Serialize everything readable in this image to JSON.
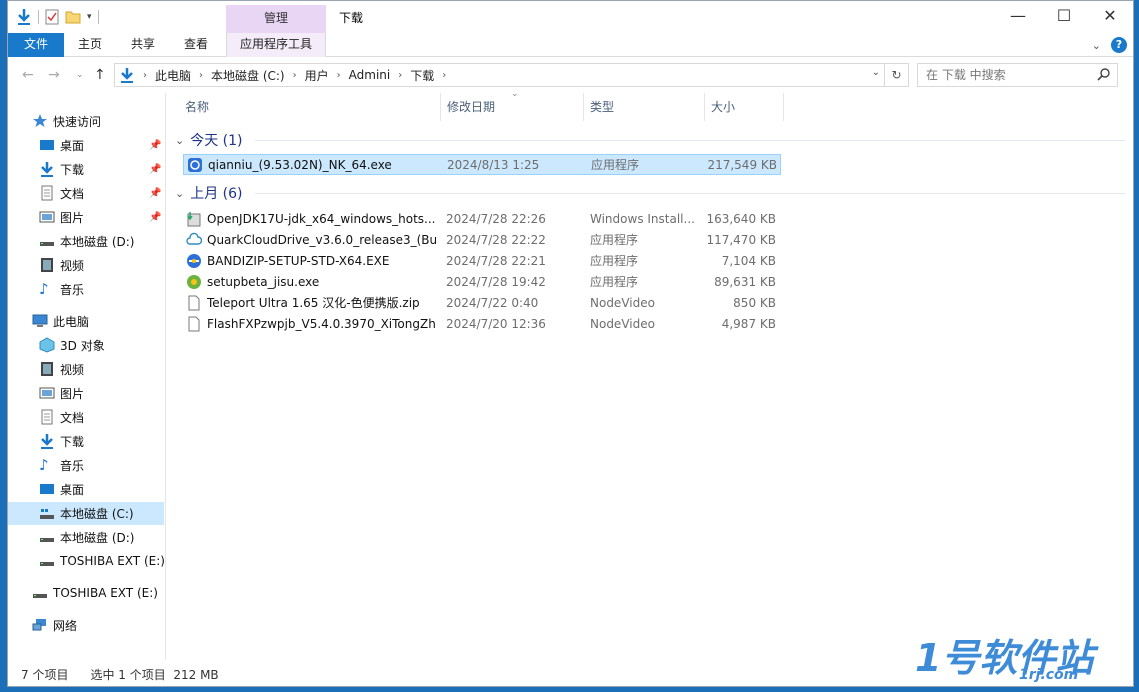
{
  "window": {
    "title": "下载",
    "context_tab_group": "管理",
    "controls": [
      "—",
      "☐",
      "✕"
    ]
  },
  "ribbon": {
    "tabs": [
      "文件",
      "主页",
      "共享",
      "查看",
      "应用程序工具"
    ]
  },
  "address": {
    "crumbs": [
      "此电脑",
      "本地磁盘 (C:)",
      "用户",
      "Admini",
      "下载"
    ],
    "search_placeholder": "在 下载 中搜索"
  },
  "nav": {
    "quick_access": "快速访问",
    "quick_items": [
      "桌面",
      "下载",
      "文档",
      "图片",
      "本地磁盘 (D:)",
      "视频",
      "音乐"
    ],
    "this_pc": "此电脑",
    "pc_items": [
      "3D 对象",
      "视频",
      "图片",
      "文档",
      "下载",
      "音乐",
      "桌面",
      "本地磁盘 (C:)",
      "本地磁盘 (D:)",
      "TOSHIBA EXT (E:)"
    ],
    "external": "TOSHIBA EXT (E:)",
    "network": "网络"
  },
  "columns": [
    "名称",
    "修改日期",
    "类型",
    "大小"
  ],
  "groups": [
    {
      "label": "今天 (1)",
      "files": [
        {
          "name": "qianniu_(9.53.02N)_NK_64.exe",
          "date": "2024/8/13 1:25",
          "type": "应用程序",
          "size": "217,549 KB",
          "icon": "app-icon"
        }
      ]
    },
    {
      "label": "上月 (6)",
      "files": [
        {
          "name": "OpenJDK17U-jdk_x64_windows_hots...",
          "date": "2024/7/28 22:26",
          "type": "Windows Install...",
          "size": "163,640 KB",
          "icon": "msi-icon"
        },
        {
          "name": "QuarkCloudDrive_v3.6.0_release3_(Bu...",
          "date": "2024/7/28 22:22",
          "type": "应用程序",
          "size": "117,470 KB",
          "icon": "cloud-icon"
        },
        {
          "name": "BANDIZIP-SETUP-STD-X64.EXE",
          "date": "2024/7/28 22:21",
          "type": "应用程序",
          "size": "7,104 KB",
          "icon": "bandizip-icon"
        },
        {
          "name": "setupbeta_jisu.exe",
          "date": "2024/7/28 19:42",
          "type": "应用程序",
          "size": "89,631 KB",
          "icon": "setup-icon"
        },
        {
          "name": "Teleport Ultra 1.65 汉化-色便携版.zip",
          "date": "2024/7/22 0:40",
          "type": "NodeVideo",
          "size": "850 KB",
          "icon": "document-icon"
        },
        {
          "name": "FlashFXPzwpjb_V5.4.0.3970_XiTongZh...",
          "date": "2024/7/20 12:36",
          "type": "NodeVideo",
          "size": "4,987 KB",
          "icon": "document-icon"
        }
      ]
    }
  ],
  "status": {
    "count": "7 个项目",
    "selected": "选中 1 个项目",
    "size": "212 MB"
  },
  "watermark": {
    "main": "1号软件站",
    "sub": "1rj.com"
  }
}
